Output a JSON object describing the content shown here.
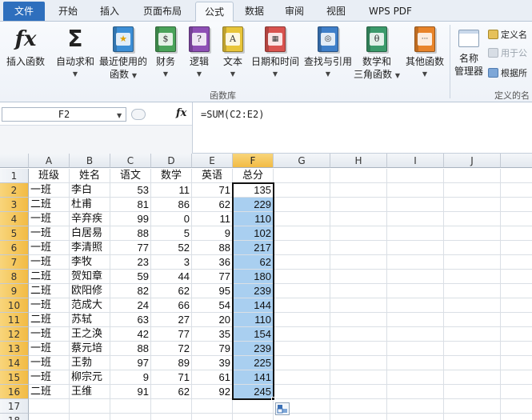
{
  "tabs": [
    {
      "label": "文件",
      "type": "file"
    },
    {
      "label": "开始"
    },
    {
      "label": "插入"
    },
    {
      "label": "页面布局"
    },
    {
      "label": "公式",
      "active": true
    },
    {
      "label": "数据"
    },
    {
      "label": "审阅"
    },
    {
      "label": "视图"
    },
    {
      "label": "WPS PDF"
    }
  ],
  "ribbon": {
    "insert_function": "插入函数",
    "autosum": "自动求和",
    "recent_line1": "最近使用的",
    "recent_line2": "函数",
    "financial": "财务",
    "logical": "逻辑",
    "text": "文本",
    "datetime": "日期和时间",
    "lookup": "查找与引用",
    "math_line1": "数学和",
    "math_line2": "三角函数",
    "more": "其他函数",
    "group_label": "函数库",
    "name_mgr_line1": "名称",
    "name_mgr_line2": "管理器",
    "define_name": "定义名",
    "use_in_formula": "用于公",
    "create_from_sel": "根据所",
    "defined_names_group": "定义的名",
    "fx_glyph": "fx",
    "sigma_glyph": "Σ",
    "book_glyphs": {
      "financial": "$",
      "logical": "?",
      "text": "A",
      "lookup": "🔍",
      "math": "θ"
    }
  },
  "colors": {
    "book_recent": "#3d8fd6",
    "book_financial": "#4aa35a",
    "book_logical": "#8e4fb5",
    "book_text": "#e8c53a",
    "book_datetime": "#d9534f",
    "book_lookup": "#3f7fc9",
    "book_math": "#3b9a6b",
    "book_more": "#e8842a"
  },
  "formula_bar": {
    "name_box": "F2",
    "fx_label": "fx",
    "formula": "=SUM(C2:E2)"
  },
  "grid": {
    "columns": [
      "A",
      "B",
      "C",
      "D",
      "E",
      "F",
      "G",
      "H",
      "I",
      "J"
    ],
    "rows": [
      "1",
      "2",
      "3",
      "4",
      "5",
      "6",
      "7",
      "8",
      "9",
      "10",
      "11",
      "12",
      "13",
      "14",
      "15",
      "16",
      "17",
      "18"
    ],
    "header_row": [
      "班级",
      "姓名",
      "语文",
      "数学",
      "英语",
      "总分"
    ],
    "data": [
      [
        "一班",
        "李白",
        "53",
        "11",
        "71",
        "135"
      ],
      [
        "二班",
        "杜甫",
        "81",
        "86",
        "62",
        "229"
      ],
      [
        "一班",
        "辛弃疾",
        "99",
        "0",
        "11",
        "110"
      ],
      [
        "一班",
        "白居易",
        "88",
        "5",
        "9",
        "102"
      ],
      [
        "一班",
        "李清照",
        "77",
        "52",
        "88",
        "217"
      ],
      [
        "一班",
        "李牧",
        "23",
        "3",
        "36",
        "62"
      ],
      [
        "二班",
        "贺知章",
        "59",
        "44",
        "77",
        "180"
      ],
      [
        "二班",
        "欧阳修",
        "82",
        "62",
        "95",
        "239"
      ],
      [
        "一班",
        "范成大",
        "24",
        "66",
        "54",
        "144"
      ],
      [
        "二班",
        "苏轼",
        "63",
        "27",
        "20",
        "110"
      ],
      [
        "一班",
        "王之涣",
        "42",
        "77",
        "35",
        "154"
      ],
      [
        "一班",
        "蔡元培",
        "88",
        "72",
        "79",
        "239"
      ],
      [
        "一班",
        "王勃",
        "97",
        "89",
        "39",
        "225"
      ],
      [
        "一班",
        "柳宗元",
        "9",
        "71",
        "61",
        "141"
      ],
      [
        "二班",
        "王维",
        "91",
        "62",
        "92",
        "245"
      ]
    ]
  }
}
